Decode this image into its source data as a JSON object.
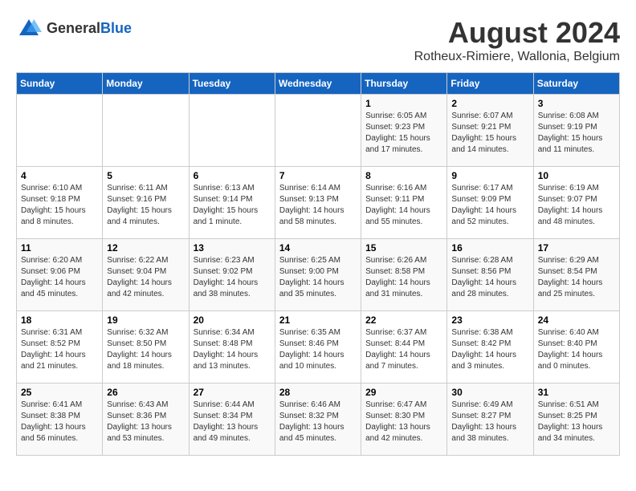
{
  "logo": {
    "general": "General",
    "blue": "Blue"
  },
  "title": "August 2024",
  "location": "Rotheux-Rimiere, Wallonia, Belgium",
  "headers": [
    "Sunday",
    "Monday",
    "Tuesday",
    "Wednesday",
    "Thursday",
    "Friday",
    "Saturday"
  ],
  "weeks": [
    [
      {
        "day": "",
        "info": ""
      },
      {
        "day": "",
        "info": ""
      },
      {
        "day": "",
        "info": ""
      },
      {
        "day": "",
        "info": ""
      },
      {
        "day": "1",
        "info": "Sunrise: 6:05 AM\nSunset: 9:23 PM\nDaylight: 15 hours and 17 minutes."
      },
      {
        "day": "2",
        "info": "Sunrise: 6:07 AM\nSunset: 9:21 PM\nDaylight: 15 hours and 14 minutes."
      },
      {
        "day": "3",
        "info": "Sunrise: 6:08 AM\nSunset: 9:19 PM\nDaylight: 15 hours and 11 minutes."
      }
    ],
    [
      {
        "day": "4",
        "info": "Sunrise: 6:10 AM\nSunset: 9:18 PM\nDaylight: 15 hours and 8 minutes."
      },
      {
        "day": "5",
        "info": "Sunrise: 6:11 AM\nSunset: 9:16 PM\nDaylight: 15 hours and 4 minutes."
      },
      {
        "day": "6",
        "info": "Sunrise: 6:13 AM\nSunset: 9:14 PM\nDaylight: 15 hours and 1 minute."
      },
      {
        "day": "7",
        "info": "Sunrise: 6:14 AM\nSunset: 9:13 PM\nDaylight: 14 hours and 58 minutes."
      },
      {
        "day": "8",
        "info": "Sunrise: 6:16 AM\nSunset: 9:11 PM\nDaylight: 14 hours and 55 minutes."
      },
      {
        "day": "9",
        "info": "Sunrise: 6:17 AM\nSunset: 9:09 PM\nDaylight: 14 hours and 52 minutes."
      },
      {
        "day": "10",
        "info": "Sunrise: 6:19 AM\nSunset: 9:07 PM\nDaylight: 14 hours and 48 minutes."
      }
    ],
    [
      {
        "day": "11",
        "info": "Sunrise: 6:20 AM\nSunset: 9:06 PM\nDaylight: 14 hours and 45 minutes."
      },
      {
        "day": "12",
        "info": "Sunrise: 6:22 AM\nSunset: 9:04 PM\nDaylight: 14 hours and 42 minutes."
      },
      {
        "day": "13",
        "info": "Sunrise: 6:23 AM\nSunset: 9:02 PM\nDaylight: 14 hours and 38 minutes."
      },
      {
        "day": "14",
        "info": "Sunrise: 6:25 AM\nSunset: 9:00 PM\nDaylight: 14 hours and 35 minutes."
      },
      {
        "day": "15",
        "info": "Sunrise: 6:26 AM\nSunset: 8:58 PM\nDaylight: 14 hours and 31 minutes."
      },
      {
        "day": "16",
        "info": "Sunrise: 6:28 AM\nSunset: 8:56 PM\nDaylight: 14 hours and 28 minutes."
      },
      {
        "day": "17",
        "info": "Sunrise: 6:29 AM\nSunset: 8:54 PM\nDaylight: 14 hours and 25 minutes."
      }
    ],
    [
      {
        "day": "18",
        "info": "Sunrise: 6:31 AM\nSunset: 8:52 PM\nDaylight: 14 hours and 21 minutes."
      },
      {
        "day": "19",
        "info": "Sunrise: 6:32 AM\nSunset: 8:50 PM\nDaylight: 14 hours and 18 minutes."
      },
      {
        "day": "20",
        "info": "Sunrise: 6:34 AM\nSunset: 8:48 PM\nDaylight: 14 hours and 13 minutes."
      },
      {
        "day": "21",
        "info": "Sunrise: 6:35 AM\nSunset: 8:46 PM\nDaylight: 14 hours and 10 minutes."
      },
      {
        "day": "22",
        "info": "Sunrise: 6:37 AM\nSunset: 8:44 PM\nDaylight: 14 hours and 7 minutes."
      },
      {
        "day": "23",
        "info": "Sunrise: 6:38 AM\nSunset: 8:42 PM\nDaylight: 14 hours and 3 minutes."
      },
      {
        "day": "24",
        "info": "Sunrise: 6:40 AM\nSunset: 8:40 PM\nDaylight: 14 hours and 0 minutes."
      }
    ],
    [
      {
        "day": "25",
        "info": "Sunrise: 6:41 AM\nSunset: 8:38 PM\nDaylight: 13 hours and 56 minutes."
      },
      {
        "day": "26",
        "info": "Sunrise: 6:43 AM\nSunset: 8:36 PM\nDaylight: 13 hours and 53 minutes."
      },
      {
        "day": "27",
        "info": "Sunrise: 6:44 AM\nSunset: 8:34 PM\nDaylight: 13 hours and 49 minutes."
      },
      {
        "day": "28",
        "info": "Sunrise: 6:46 AM\nSunset: 8:32 PM\nDaylight: 13 hours and 45 minutes."
      },
      {
        "day": "29",
        "info": "Sunrise: 6:47 AM\nSunset: 8:30 PM\nDaylight: 13 hours and 42 minutes."
      },
      {
        "day": "30",
        "info": "Sunrise: 6:49 AM\nSunset: 8:27 PM\nDaylight: 13 hours and 38 minutes."
      },
      {
        "day": "31",
        "info": "Sunrise: 6:51 AM\nSunset: 8:25 PM\nDaylight: 13 hours and 34 minutes."
      }
    ]
  ]
}
